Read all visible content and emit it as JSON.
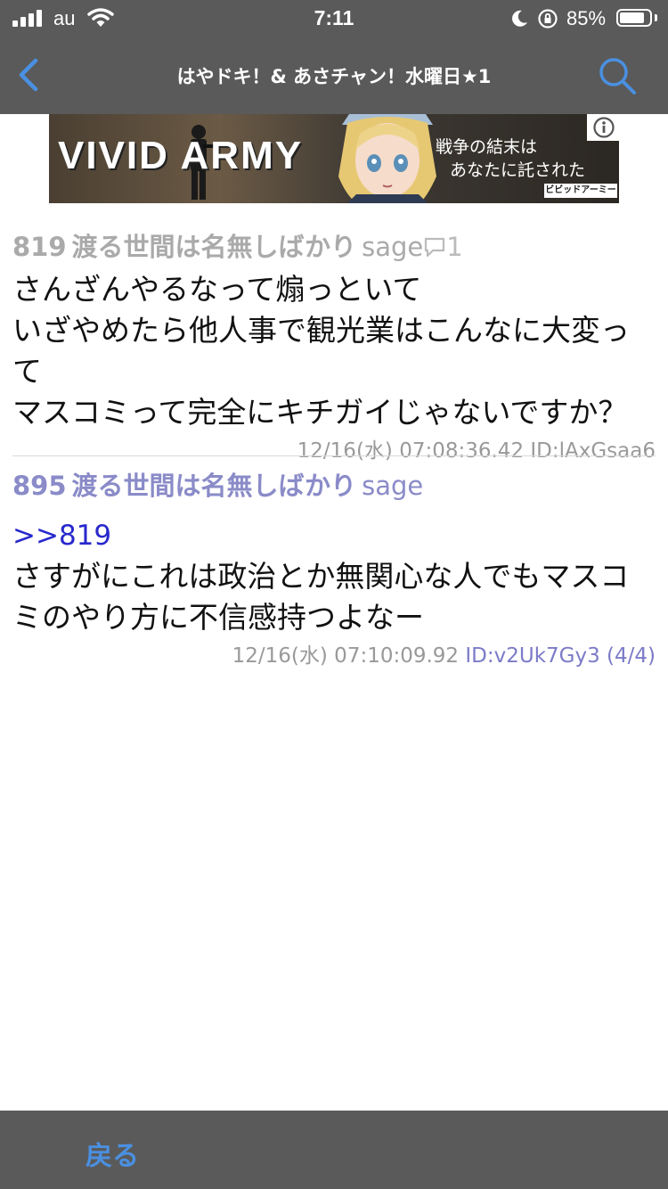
{
  "status_bar": {
    "carrier": "au",
    "time": "7:11",
    "battery_percent": "85%",
    "battery_level": 0.85,
    "icons": [
      "signal-icon",
      "wifi-icon",
      "moon-icon",
      "rotation-lock-icon",
      "battery-icon"
    ]
  },
  "nav": {
    "title": "はやドキ！& あさチャン！水曜日★1",
    "back_icon": "chevron-left-icon",
    "search_icon": "search-icon",
    "accent_color": "#4a90e2"
  },
  "ad": {
    "title": "VIVID ARMY",
    "tagline_line1": "戦争の結末は",
    "tagline_line2": "あなたに託された",
    "logo_text": "ビビッドアーミー",
    "info_icon": "info-icon"
  },
  "posts": [
    {
      "number": "819",
      "name": "渡る世間は名無しばかり",
      "mail": "sage",
      "reply_count": "1",
      "lines": [
        "さんざんやるなって煽っといて",
        "いざやめたら他人事で観光業はこんなに大変っ",
        "て",
        "マスコミって完全にキチガイじゃないですか？"
      ],
      "meta": "12/16(水) 07:08:36.42 ID:lAxGsaa6"
    },
    {
      "number": "895",
      "name": "渡る世間は名無しばかり",
      "mail": "sage",
      "anchor": ">>819",
      "lines": [
        "さすがにこれは政治とか無関心な人でもマスコ",
        "ミのやり方に不信感持つよなー"
      ],
      "meta_date": "12/16(水) 07:10:09.92",
      "meta_id": "ID:v2Uk7Gy3 (4/4)"
    }
  ],
  "toolbar": {
    "back_label": "戻る"
  }
}
